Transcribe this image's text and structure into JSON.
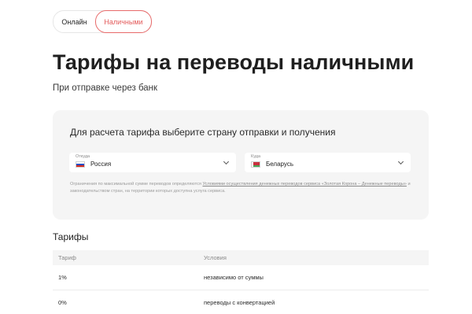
{
  "tabs": {
    "online": "Онлайн",
    "cash": "Наличными"
  },
  "page": {
    "title": "Тарифы на переводы наличными",
    "subtitle": "При отправке через банк"
  },
  "calculator": {
    "heading": "Для расчета тарифа выберите страну отправки и получения",
    "from": {
      "caption": "Откуда",
      "value": "Россия",
      "flag": "flag-russia"
    },
    "to": {
      "caption": "Куда",
      "value": "Беларусь",
      "flag": "flag-belarus"
    },
    "disclaimer": {
      "text1": "Ограничения по максимальной сумме переводов определяются ",
      "link1": "Условиями осуществления денежных переводов сервиса «Золотая Корона – Денежные переводы»",
      "text2": " и законодательством стран, на территории которых доступна услуга сервиса."
    }
  },
  "tariffs": {
    "heading": "Тарифы",
    "columns": {
      "rate": "Тариф",
      "condition": "Условия"
    },
    "rows": [
      {
        "rate": "1%",
        "condition": "независимо от суммы"
      },
      {
        "rate": "0%",
        "condition": "переводы с конвертацией"
      }
    ]
  },
  "colors": {
    "accent": "#e86a6a",
    "panel": "#f5f5f5"
  }
}
